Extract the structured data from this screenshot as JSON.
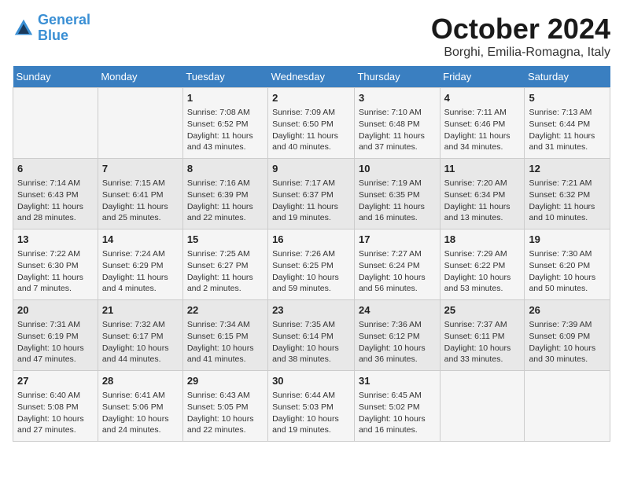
{
  "logo": {
    "line1": "General",
    "line2": "Blue"
  },
  "title": "October 2024",
  "subtitle": "Borghi, Emilia-Romagna, Italy",
  "days_of_week": [
    "Sunday",
    "Monday",
    "Tuesday",
    "Wednesday",
    "Thursday",
    "Friday",
    "Saturday"
  ],
  "weeks": [
    [
      {
        "day": "",
        "info": ""
      },
      {
        "day": "",
        "info": ""
      },
      {
        "day": "1",
        "info": "Sunrise: 7:08 AM\nSunset: 6:52 PM\nDaylight: 11 hours and 43 minutes."
      },
      {
        "day": "2",
        "info": "Sunrise: 7:09 AM\nSunset: 6:50 PM\nDaylight: 11 hours and 40 minutes."
      },
      {
        "day": "3",
        "info": "Sunrise: 7:10 AM\nSunset: 6:48 PM\nDaylight: 11 hours and 37 minutes."
      },
      {
        "day": "4",
        "info": "Sunrise: 7:11 AM\nSunset: 6:46 PM\nDaylight: 11 hours and 34 minutes."
      },
      {
        "day": "5",
        "info": "Sunrise: 7:13 AM\nSunset: 6:44 PM\nDaylight: 11 hours and 31 minutes."
      }
    ],
    [
      {
        "day": "6",
        "info": "Sunrise: 7:14 AM\nSunset: 6:43 PM\nDaylight: 11 hours and 28 minutes."
      },
      {
        "day": "7",
        "info": "Sunrise: 7:15 AM\nSunset: 6:41 PM\nDaylight: 11 hours and 25 minutes."
      },
      {
        "day": "8",
        "info": "Sunrise: 7:16 AM\nSunset: 6:39 PM\nDaylight: 11 hours and 22 minutes."
      },
      {
        "day": "9",
        "info": "Sunrise: 7:17 AM\nSunset: 6:37 PM\nDaylight: 11 hours and 19 minutes."
      },
      {
        "day": "10",
        "info": "Sunrise: 7:19 AM\nSunset: 6:35 PM\nDaylight: 11 hours and 16 minutes."
      },
      {
        "day": "11",
        "info": "Sunrise: 7:20 AM\nSunset: 6:34 PM\nDaylight: 11 hours and 13 minutes."
      },
      {
        "day": "12",
        "info": "Sunrise: 7:21 AM\nSunset: 6:32 PM\nDaylight: 11 hours and 10 minutes."
      }
    ],
    [
      {
        "day": "13",
        "info": "Sunrise: 7:22 AM\nSunset: 6:30 PM\nDaylight: 11 hours and 7 minutes."
      },
      {
        "day": "14",
        "info": "Sunrise: 7:24 AM\nSunset: 6:29 PM\nDaylight: 11 hours and 4 minutes."
      },
      {
        "day": "15",
        "info": "Sunrise: 7:25 AM\nSunset: 6:27 PM\nDaylight: 11 hours and 2 minutes."
      },
      {
        "day": "16",
        "info": "Sunrise: 7:26 AM\nSunset: 6:25 PM\nDaylight: 10 hours and 59 minutes."
      },
      {
        "day": "17",
        "info": "Sunrise: 7:27 AM\nSunset: 6:24 PM\nDaylight: 10 hours and 56 minutes."
      },
      {
        "day": "18",
        "info": "Sunrise: 7:29 AM\nSunset: 6:22 PM\nDaylight: 10 hours and 53 minutes."
      },
      {
        "day": "19",
        "info": "Sunrise: 7:30 AM\nSunset: 6:20 PM\nDaylight: 10 hours and 50 minutes."
      }
    ],
    [
      {
        "day": "20",
        "info": "Sunrise: 7:31 AM\nSunset: 6:19 PM\nDaylight: 10 hours and 47 minutes."
      },
      {
        "day": "21",
        "info": "Sunrise: 7:32 AM\nSunset: 6:17 PM\nDaylight: 10 hours and 44 minutes."
      },
      {
        "day": "22",
        "info": "Sunrise: 7:34 AM\nSunset: 6:15 PM\nDaylight: 10 hours and 41 minutes."
      },
      {
        "day": "23",
        "info": "Sunrise: 7:35 AM\nSunset: 6:14 PM\nDaylight: 10 hours and 38 minutes."
      },
      {
        "day": "24",
        "info": "Sunrise: 7:36 AM\nSunset: 6:12 PM\nDaylight: 10 hours and 36 minutes."
      },
      {
        "day": "25",
        "info": "Sunrise: 7:37 AM\nSunset: 6:11 PM\nDaylight: 10 hours and 33 minutes."
      },
      {
        "day": "26",
        "info": "Sunrise: 7:39 AM\nSunset: 6:09 PM\nDaylight: 10 hours and 30 minutes."
      }
    ],
    [
      {
        "day": "27",
        "info": "Sunrise: 6:40 AM\nSunset: 5:08 PM\nDaylight: 10 hours and 27 minutes."
      },
      {
        "day": "28",
        "info": "Sunrise: 6:41 AM\nSunset: 5:06 PM\nDaylight: 10 hours and 24 minutes."
      },
      {
        "day": "29",
        "info": "Sunrise: 6:43 AM\nSunset: 5:05 PM\nDaylight: 10 hours and 22 minutes."
      },
      {
        "day": "30",
        "info": "Sunrise: 6:44 AM\nSunset: 5:03 PM\nDaylight: 10 hours and 19 minutes."
      },
      {
        "day": "31",
        "info": "Sunrise: 6:45 AM\nSunset: 5:02 PM\nDaylight: 10 hours and 16 minutes."
      },
      {
        "day": "",
        "info": ""
      },
      {
        "day": "",
        "info": ""
      }
    ]
  ]
}
